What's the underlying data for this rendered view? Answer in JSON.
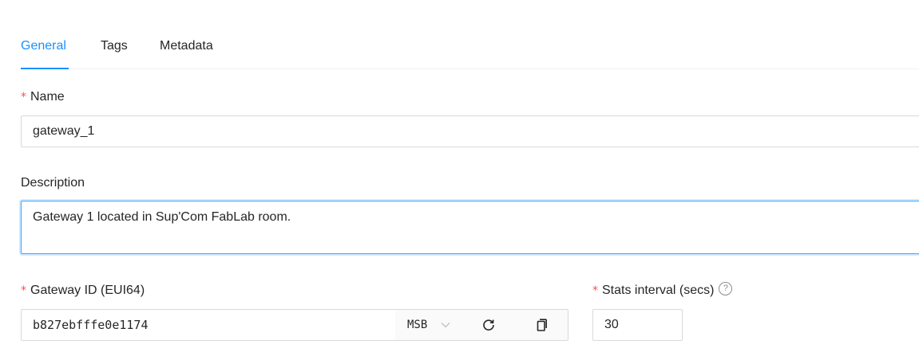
{
  "tabs": [
    {
      "label": "General",
      "active": true
    },
    {
      "label": "Tags",
      "active": false
    },
    {
      "label": "Metadata",
      "active": false
    }
  ],
  "form": {
    "name": {
      "label": "Name",
      "required": true,
      "value": "gateway_1"
    },
    "description": {
      "label": "Description",
      "required": false,
      "value": "Gateway 1 located in Sup'Com FabLab room."
    },
    "gateway_id": {
      "label": "Gateway ID (EUI64)",
      "required": true,
      "value": "b827ebfffe0e1174",
      "byte_order": "MSB",
      "refresh_icon": "refresh-icon",
      "copy_icon": "copy-icon"
    },
    "stats_interval": {
      "label": "Stats interval (secs)",
      "required": true,
      "value": "30",
      "help_icon": "question-circle-icon"
    }
  },
  "colors": {
    "accent": "#1890ff",
    "required": "#ff4d4f",
    "border": "#d9d9d9"
  }
}
